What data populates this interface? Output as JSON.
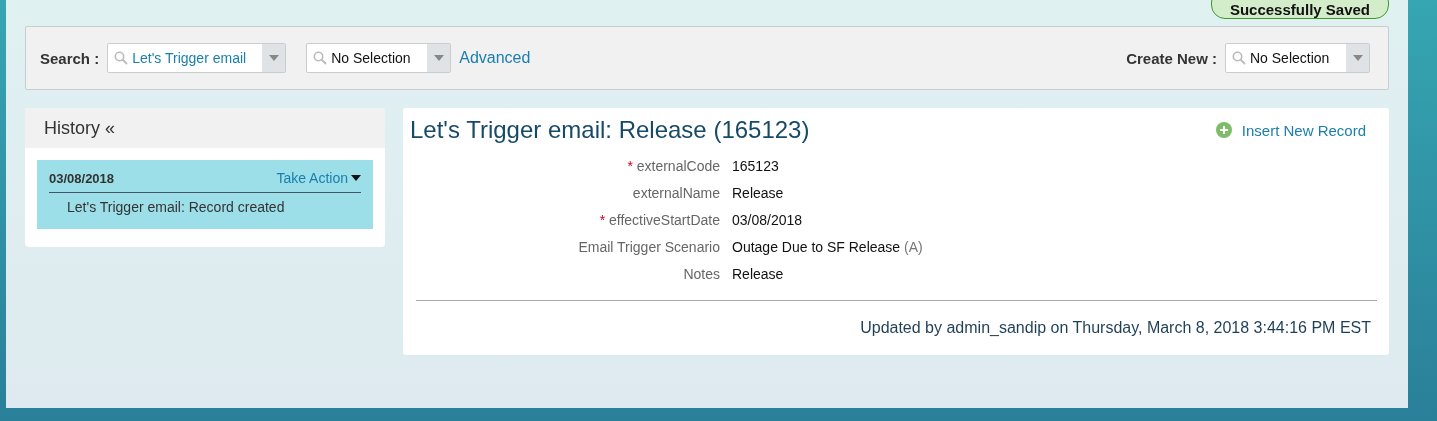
{
  "toast": {
    "text": "Successfully Saved"
  },
  "search_bar": {
    "label": "Search :",
    "search_field": {
      "value": "Let's Trigger email"
    },
    "type_field": {
      "value": "No Selection"
    },
    "advanced_link": "Advanced",
    "create_label": "Create New :",
    "create_field": {
      "value": "No Selection"
    }
  },
  "history": {
    "title": "History «",
    "entries": [
      {
        "date": "03/08/2018",
        "action": "Take Action",
        "text": "Let's Trigger email: Record created",
        "selected": true
      }
    ]
  },
  "record": {
    "title": "Let's Trigger email: Release (165123)",
    "insert_button": "Insert New Record",
    "fields": [
      {
        "label": "externalCode",
        "required_mark": "*",
        "value": "165123"
      },
      {
        "label": "externalName",
        "value": "Release"
      },
      {
        "label": "effectiveStartDate",
        "required_mark": "*",
        "value": "03/08/2018"
      },
      {
        "label": "Email Trigger Scenario",
        "value": "Outage Due to SF Release",
        "suffix": "(A)"
      },
      {
        "label": "Notes",
        "value": "Release"
      }
    ],
    "updated": "Updated by admin_sandip on Thursday, March 8, 2018 3:44:16 PM EST"
  }
}
